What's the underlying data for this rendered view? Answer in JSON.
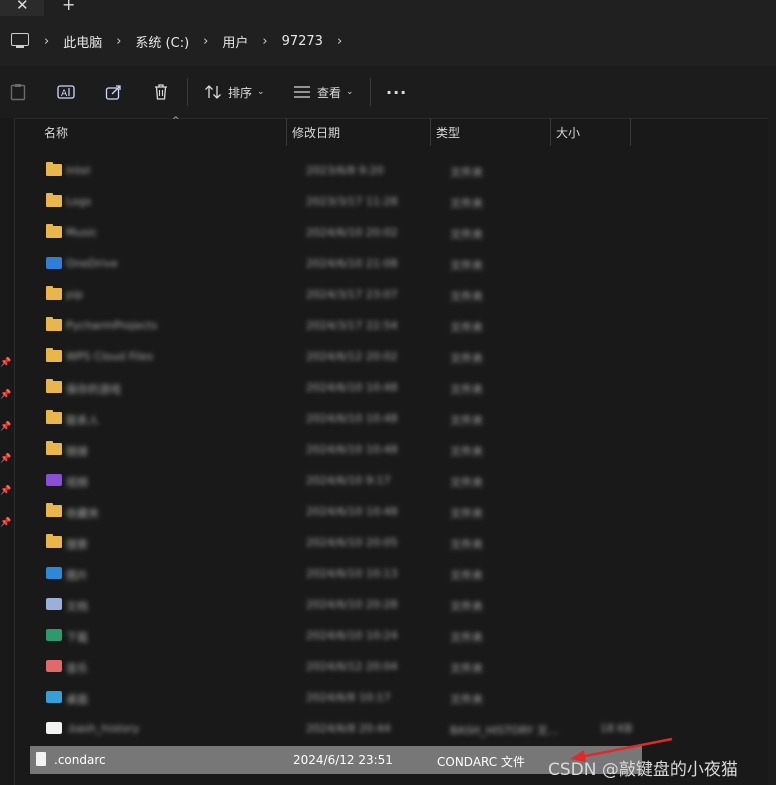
{
  "breadcrumb": [
    "此电脑",
    "系统 (C:)",
    "用户",
    "97273"
  ],
  "toolbar": {
    "sort_label": "排序",
    "view_label": "查看",
    "more_label": "···"
  },
  "columns": {
    "name": "名称",
    "date": "修改日期",
    "type": "类型",
    "size": "大小"
  },
  "rows": [
    {
      "icon": "folder-icon",
      "name": "Intel",
      "date": "2023/6/8 9:20",
      "type": "文件夹",
      "size": ""
    },
    {
      "icon": "folder-icon",
      "name": "Logs",
      "date": "2023/3/17 11:28",
      "type": "文件夹",
      "size": ""
    },
    {
      "icon": "folder-icon",
      "name": "Music",
      "date": "2024/6/10 20:02",
      "type": "文件夹",
      "size": ""
    },
    {
      "icon": "onedrive-icon",
      "name": "OneDrive",
      "date": "2024/6/10 21:08",
      "type": "文件夹",
      "size": ""
    },
    {
      "icon": "folder-icon",
      "name": "pip",
      "date": "2024/3/17 23:07",
      "type": "文件夹",
      "size": ""
    },
    {
      "icon": "folder-icon",
      "name": "PycharmProjects",
      "date": "2024/3/17 22:54",
      "type": "文件夹",
      "size": ""
    },
    {
      "icon": "folder-icon",
      "name": "WPS Cloud Files",
      "date": "2024/6/12 20:02",
      "type": "文件夹",
      "size": ""
    },
    {
      "icon": "folder-icon",
      "name": "保存的游戏",
      "date": "2024/6/10 10:48",
      "type": "文件夹",
      "size": ""
    },
    {
      "icon": "folder-icon",
      "name": "联系人",
      "date": "2024/6/10 10:48",
      "type": "文件夹",
      "size": ""
    },
    {
      "icon": "folder-icon",
      "name": "链接",
      "date": "2024/6/10 10:48",
      "type": "文件夹",
      "size": ""
    },
    {
      "icon": "video-icon",
      "name": "视频",
      "date": "2024/6/10 9:17",
      "type": "文件夹",
      "size": ""
    },
    {
      "icon": "folder-icon",
      "name": "收藏夹",
      "date": "2024/6/10 10:48",
      "type": "文件夹",
      "size": ""
    },
    {
      "icon": "folder-icon",
      "name": "搜索",
      "date": "2024/6/10 20:05",
      "type": "文件夹",
      "size": ""
    },
    {
      "icon": "pictures-icon",
      "name": "图片",
      "date": "2024/6/10 10:13",
      "type": "文件夹",
      "size": ""
    },
    {
      "icon": "documents-icon",
      "name": "文档",
      "date": "2024/6/10 20:28",
      "type": "文件夹",
      "size": ""
    },
    {
      "icon": "downloads-icon",
      "name": "下载",
      "date": "2024/6/10 10:24",
      "type": "文件夹",
      "size": ""
    },
    {
      "icon": "music-icon",
      "name": "音乐",
      "date": "2024/6/12 20:04",
      "type": "文件夹",
      "size": ""
    },
    {
      "icon": "desktop-icon",
      "name": "桌面",
      "date": "2024/6/8 10:17",
      "type": "文件夹",
      "size": ""
    },
    {
      "icon": "file-icon",
      "name": ".bash_history",
      "date": "2024/6/8 20:44",
      "type": "BASH_HISTORY 文...",
      "size": "18 KB"
    },
    {
      "icon": "file-icon",
      "name": ".condarc",
      "date": "2024/6/12 23:51",
      "type": "CONDARC 文件",
      "size": "",
      "selected": true
    }
  ],
  "watermark": "CSDN @敲键盘的小夜猫",
  "colors": {
    "folder": "#e8b64a",
    "selection": "#777777",
    "annotation_arrow": "#e02a2a"
  }
}
